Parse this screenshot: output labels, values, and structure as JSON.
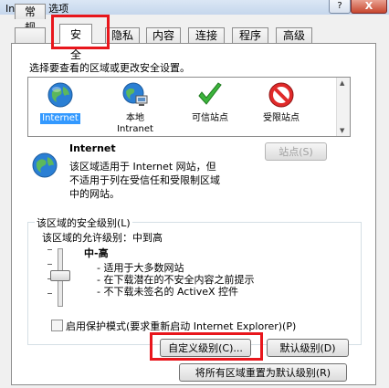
{
  "window": {
    "title": "Internet 选项",
    "help_label": "?",
    "close_label": "X"
  },
  "tabs": [
    {
      "label": "常规"
    },
    {
      "label": "安全"
    },
    {
      "label": "隐私"
    },
    {
      "label": "内容"
    },
    {
      "label": "连接"
    },
    {
      "label": "程序"
    },
    {
      "label": "高级"
    }
  ],
  "zone_prompt": "选择要查看的区域或更改安全设置。",
  "zones": [
    {
      "label": "Internet",
      "icon": "globe-icon",
      "selected": true
    },
    {
      "label": "本地\nIntranet",
      "icon": "intranet-icon",
      "selected": false
    },
    {
      "label": "可信站点",
      "icon": "checkmark-icon",
      "selected": false
    },
    {
      "label": "受限站点",
      "icon": "no-entry-icon",
      "selected": false
    }
  ],
  "zone_info": {
    "title": "Internet",
    "description_lines": [
      "该区域适用于 Internet 网站，但",
      "不适用于列在受信任和受限制区域",
      "中的网站。"
    ]
  },
  "sites_button": "站点(S)",
  "security_level": {
    "group_title": "该区域的安全级别(L)",
    "allowed_levels": "该区域的允许级别：中到高",
    "level_name": "中-高",
    "bullets": [
      "- 适用于大多数网站",
      "- 在下载潜在的不安全内容之前提示",
      "- 不下载未签名的 ActiveX 控件"
    ]
  },
  "protected_mode": {
    "label": "启用保护模式(要求重新启动 Internet Explorer)(P)",
    "checked": false
  },
  "buttons": {
    "custom_level": "自定义级别(C)...",
    "default_level": "默认级别(D)",
    "reset_all": "将所有区域重置为默认级别(R)"
  },
  "colors": {
    "highlight": "#e8161c",
    "selection": "#3399ff"
  }
}
